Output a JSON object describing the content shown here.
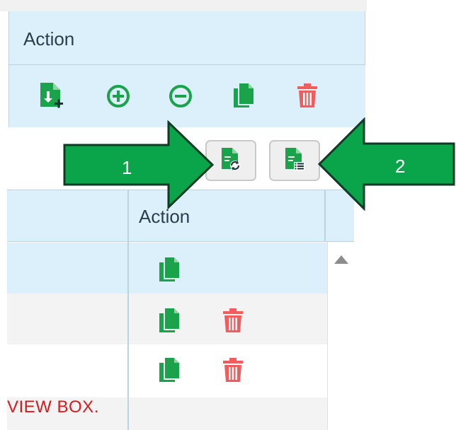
{
  "top_table": {
    "header": "Action",
    "icons": [
      "add-file-icon",
      "plus-circle-icon",
      "minus-circle-icon",
      "copy-icon",
      "trash-icon"
    ]
  },
  "toolbar": {
    "buttons": [
      {
        "icon": "refresh-document-icon"
      },
      {
        "icon": "document-list-icon"
      }
    ]
  },
  "callouts": {
    "arrow1": "1",
    "arrow2": "2"
  },
  "bottom_table": {
    "header": "Action",
    "rows": [
      {
        "icons": [
          "copy-icon"
        ]
      },
      {
        "icons": [
          "copy-icon",
          "trash-icon"
        ]
      },
      {
        "icons": [
          "copy-icon",
          "trash-icon"
        ]
      }
    ],
    "warning_text": "VIEW BOX."
  },
  "colors": {
    "header_bg": "#dcf0fb",
    "icon_green": "#1aa34a",
    "icon_red": "#f25c5c",
    "arrow_green": "#0aa44b",
    "warning_red": "#d7191c"
  }
}
